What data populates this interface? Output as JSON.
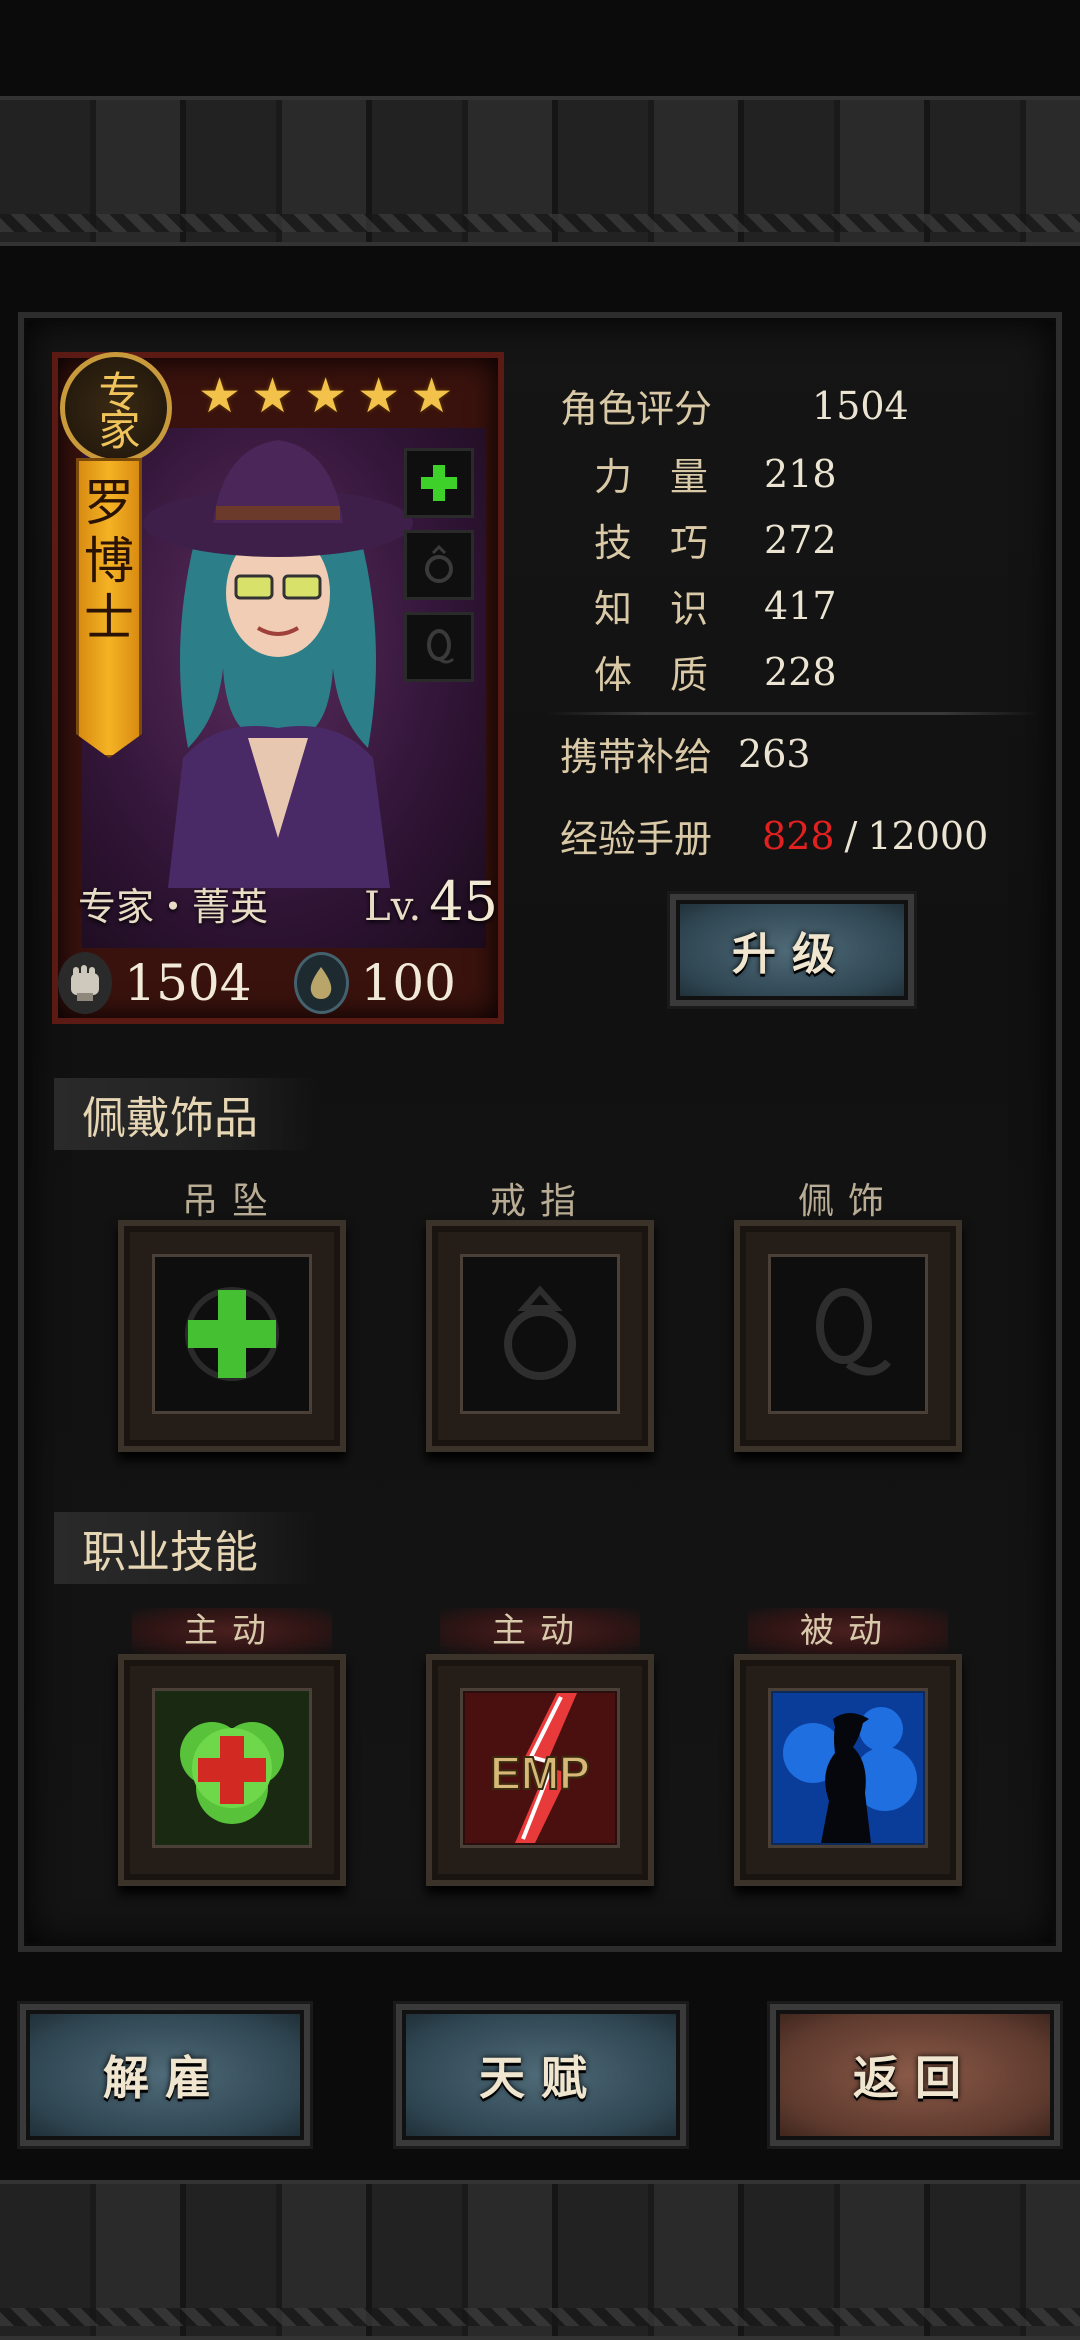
{
  "character": {
    "class_badge": "专家",
    "name": [
      "罗",
      "博",
      "士"
    ],
    "stars": 5,
    "rank_label": "专家・菁英",
    "level_label": "Lv.",
    "level": "45",
    "power": "1504",
    "supply": "100"
  },
  "stats": {
    "rating_label": "角色评分",
    "rating_value": "1504",
    "strength_label": "力　量",
    "strength_value": "218",
    "skill_label": "技　巧",
    "skill_value": "272",
    "knowledge_label": "知　识",
    "knowledge_value": "417",
    "constitution_label": "体　质",
    "constitution_value": "228",
    "carry_label": "携带补给",
    "carry_value": "263",
    "exp_label": "经验手册",
    "exp_current": "828",
    "exp_separator": "/",
    "exp_total": "12000"
  },
  "upgrade_button": "升级",
  "accessories": {
    "title": "佩戴饰品",
    "slots": [
      {
        "label": "吊坠",
        "icon": "green-cross-icon"
      },
      {
        "label": "戒指",
        "icon": "ring-icon"
      },
      {
        "label": "佩饰",
        "icon": "charm-icon"
      }
    ]
  },
  "skills": {
    "title": "职业技能",
    "slots": [
      {
        "tag": "主动",
        "icon": "heal-cloud-icon"
      },
      {
        "tag": "主动",
        "icon": "emp-icon",
        "icon_text": "EMP"
      },
      {
        "tag": "被动",
        "icon": "stealth-silhouette-icon"
      }
    ]
  },
  "bottom_buttons": {
    "dismiss": "解雇",
    "talent": "天赋",
    "back": "返回"
  },
  "colors": {
    "exp_current": "#e32020",
    "star": "#f2c24a",
    "banner": "#f4b324",
    "button_blue": "#3f5764",
    "button_brown": "#6e4536"
  }
}
